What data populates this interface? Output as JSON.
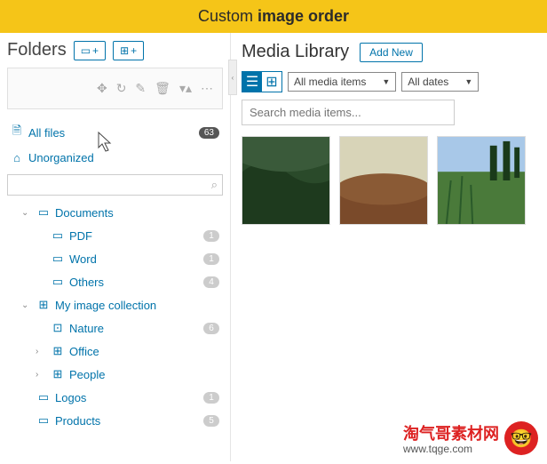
{
  "banner": {
    "prefix": "Custom ",
    "bold": "image order"
  },
  "sidebar": {
    "title": "Folders",
    "btn_folder": "+",
    "btn_box": "+",
    "allfiles": {
      "label": "All files",
      "count": "63"
    },
    "unorganized": {
      "label": "Unorganized"
    },
    "search_placeholder": "",
    "tree": [
      {
        "chev": "⌄",
        "icon": "▭",
        "label": "Documents",
        "indent": 1
      },
      {
        "icon": "▭",
        "label": "PDF",
        "badge": "1",
        "indent": 2
      },
      {
        "icon": "▭",
        "label": "Word",
        "badge": "1",
        "indent": 2
      },
      {
        "icon": "▭",
        "label": "Others",
        "badge": "4",
        "indent": 2
      },
      {
        "chev": "⌄",
        "icon": "⊞",
        "label": "My image collection",
        "indent": 1
      },
      {
        "icon": "⊡",
        "label": "Nature",
        "badge": "6",
        "indent": 2
      },
      {
        "chev": "›",
        "icon": "⊞",
        "label": "Office",
        "indent": 2
      },
      {
        "chev": "›",
        "icon": "⊞",
        "label": "People",
        "indent": 2
      },
      {
        "icon": "▭",
        "label": "Logos",
        "badge": "1",
        "indent": 1
      },
      {
        "icon": "▭",
        "label": "Products",
        "badge": "5",
        "indent": 1
      }
    ]
  },
  "content": {
    "title": "Media Library",
    "add_new": "Add New",
    "filter_media": "All media items",
    "filter_dates": "All dates",
    "search_placeholder": "Search media items..."
  },
  "watermark": {
    "main": "淘气哥素材网",
    "sub": "www.tqge.com",
    "emoji": "🤓"
  }
}
